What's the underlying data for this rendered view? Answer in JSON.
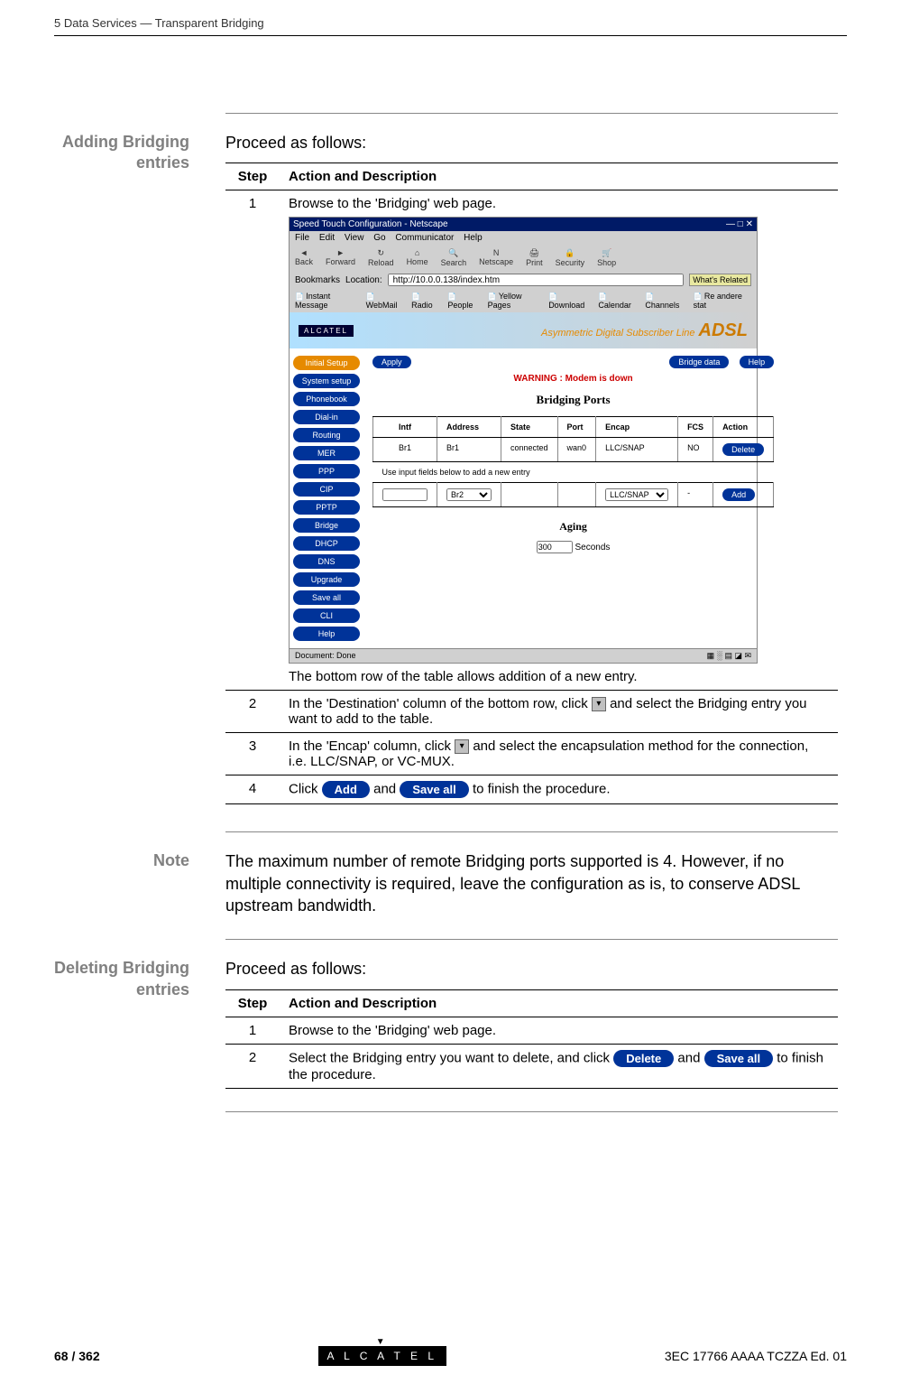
{
  "header": {
    "chapter": "5   Data Services — Transparent Bridging"
  },
  "section1": {
    "side_heading": "Adding Bridging entries",
    "intro": "Proceed as follows:",
    "table": {
      "col1": "Step",
      "col2": "Action and Description",
      "row1": {
        "step": "1",
        "text_before": "Browse to the 'Bridging' web page.",
        "text_after": "The bottom row of the table allows addition of a new entry."
      },
      "row2": {
        "step": "2",
        "text1": "In the 'Destination' column of the bottom row, click ",
        "text2": " and select the Bridging entry you want to add to the table."
      },
      "row3": {
        "step": "3",
        "text1": "In the 'Encap' column, click ",
        "text2": " and select the encapsulation method for the connection, i.e. LLC/SNAP, or VC-MUX."
      },
      "row4": {
        "step": "4",
        "text1": "Click ",
        "btn1": "Add",
        "text2": " and ",
        "btn2": "Save all",
        "text3": " to finish the procedure."
      }
    }
  },
  "screenshot": {
    "titlebar": "Speed Touch Configuration - Netscape",
    "menu": {
      "file": "File",
      "edit": "Edit",
      "view": "View",
      "go": "Go",
      "communicator": "Communicator",
      "help": "Help"
    },
    "toolbar": {
      "back": "Back",
      "forward": "Forward",
      "reload": "Reload",
      "home": "Home",
      "search": "Search",
      "netscape": "Netscape",
      "print": "Print",
      "security": "Security",
      "shop": "Shop"
    },
    "bookmarks_label": "Bookmarks",
    "location_label": "Location:",
    "location_value": "http://10.0.0.138/index.htm",
    "whats_related": "What's Related",
    "links": {
      "instant": "Instant Message",
      "webmail": "WebMail",
      "radio": "Radio",
      "people": "People",
      "yellow": "Yellow Pages",
      "download": "Download",
      "calendar": "Calendar",
      "channels": "Channels",
      "real": "Re  andere stat"
    },
    "brand": "ALCATEL",
    "banner_text": "Asymmetric Digital Subscriber Line",
    "banner_adsl": "ADSL",
    "sidebar": {
      "initial_setup": "Initial Setup",
      "system_setup": "System setup",
      "phonebook": "Phonebook",
      "dialin": "Dial-in",
      "routing": "Routing",
      "mer": "MER",
      "ppp": "PPP",
      "cip": "CIP",
      "pptp": "PPTP",
      "bridge": "Bridge",
      "dhcp": "DHCP",
      "dns": "DNS",
      "upgrade": "Upgrade",
      "saveall": "Save all",
      "cli": "CLI",
      "help": "Help"
    },
    "main": {
      "apply": "Apply",
      "bridge_data": "Bridge data",
      "help": "Help",
      "warning": "WARNING : Modem is down",
      "heading": "Bridging Ports",
      "cols": {
        "intf": "Intf",
        "address": "Address",
        "state": "State",
        "port": "Port",
        "encap": "Encap",
        "fcs": "FCS",
        "action": "Action"
      },
      "row": {
        "intf": "Br1",
        "address": "Br1",
        "state": "connected",
        "port": "wan0",
        "encap": "LLC/SNAP",
        "fcs": "NO",
        "action": "Delete"
      },
      "hint": "Use input fields below to add a new entry",
      "newrow": {
        "address": "Br2",
        "encap": "LLC/SNAP",
        "fcs": "-",
        "action": "Add"
      },
      "aging_heading": "Aging",
      "aging_value": "300",
      "aging_unit": "Seconds"
    },
    "statusbar": "Document: Done"
  },
  "note": {
    "side_heading": "Note",
    "text": "The maximum number of remote Bridging ports supported is 4. However, if no multiple connectivity is required, leave the configuration as is, to conserve ADSL upstream bandwidth."
  },
  "section2": {
    "side_heading": "Deleting Bridging entries",
    "intro": "Proceed as follows:",
    "table": {
      "col1": "Step",
      "col2": "Action and Description",
      "row1": {
        "step": "1",
        "text": "Browse to the 'Bridging' web page."
      },
      "row2": {
        "step": "2",
        "text1": "Select the Bridging entry you want to delete, and click ",
        "btn1": "Delete",
        "text2": " and ",
        "btn2": "Save all",
        "text3": " to finish the procedure."
      }
    }
  },
  "footer": {
    "page": "68 / 362",
    "brand": "A L C A T E L",
    "docid": "3EC 17766 AAAA TCZZA Ed. 01"
  }
}
